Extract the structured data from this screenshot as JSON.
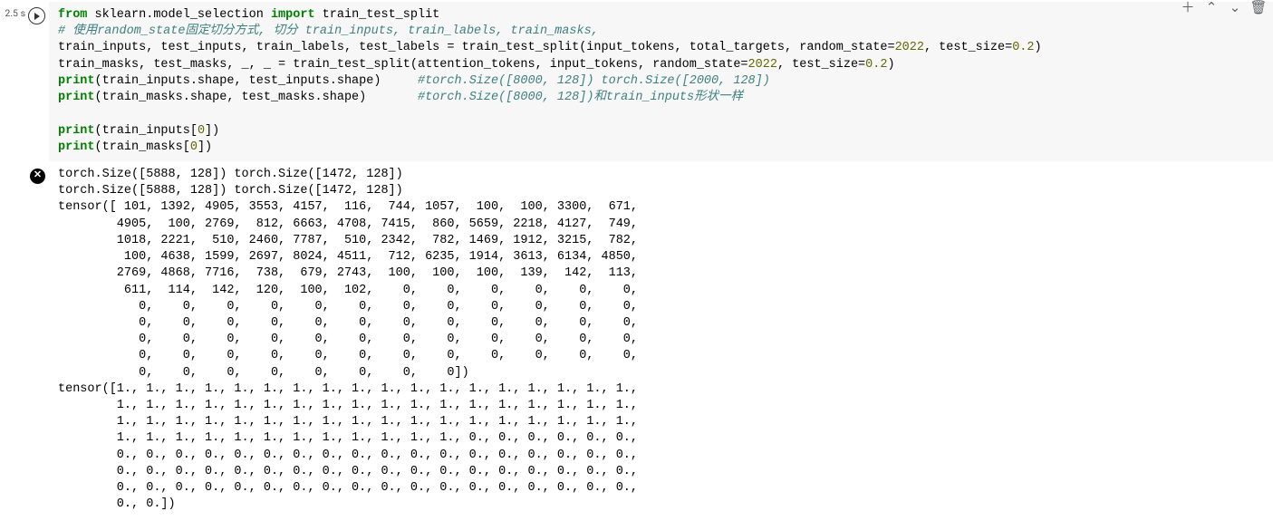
{
  "exec_time": "2.5\ns",
  "toolbar": {
    "add": "＋",
    "up": "⌃",
    "down": "⌄",
    "delete": "🗑"
  },
  "code": {
    "l1_from": "from",
    "l1_mod": " sklearn.model_selection ",
    "l1_import": "import",
    "l1_rest": " train_test_split",
    "l2_comment": "# 使用random_state固定切分方式, 切分 train_inputs, train_labels, train_masks,",
    "l3_a": "train_inputs, test_inputs, train_labels, test_labels = train_test_split(input_tokens, total_targets, random_state=",
    "l3_n1": "2022",
    "l3_b": ", test_size=",
    "l3_n2": "0.2",
    "l3_c": ")",
    "l4_a": "train_masks, test_masks, _, _ = train_test_split(attention_tokens, input_tokens, random_state=",
    "l4_n1": "2022",
    "l4_b": ", test_size=",
    "l4_n2": "0.2",
    "l4_c": ")",
    "l5_print": "print",
    "l5_a": "(train_inputs.shape, test_inputs.shape)     ",
    "l5_comment": "#torch.Size([8000, 128]) torch.Size([2000, 128])",
    "l6_print": "print",
    "l6_a": "(train_masks.shape, test_masks.shape)       ",
    "l6_comment": "#torch.Size([8000, 128])和train_inputs形状一样",
    "blank": "",
    "l7_print": "print",
    "l7_a": "(train_inputs[",
    "l7_n": "0",
    "l7_b": "])",
    "l8_print": "print",
    "l8_a": "(train_masks[",
    "l8_n": "0",
    "l8_b": "])"
  },
  "output": "torch.Size([5888, 128]) torch.Size([1472, 128])\ntorch.Size([5888, 128]) torch.Size([1472, 128])\ntensor([ 101, 1392, 4905, 3553, 4157,  116,  744, 1057,  100,  100, 3300,  671,\n        4905,  100, 2769,  812, 6663, 4708, 7415,  860, 5659, 2218, 4127,  749,\n        1018, 2221,  510, 2460, 7787,  510, 2342,  782, 1469, 1912, 3215,  782,\n         100, 4638, 1599, 2697, 8024, 4511,  712, 6235, 1914, 3613, 6134, 4850,\n        2769, 4868, 7716,  738,  679, 2743,  100,  100,  100,  139,  142,  113,\n         611,  114,  142,  120,  100,  102,    0,    0,    0,    0,    0,    0,\n           0,    0,    0,    0,    0,    0,    0,    0,    0,    0,    0,    0,\n           0,    0,    0,    0,    0,    0,    0,    0,    0,    0,    0,    0,\n           0,    0,    0,    0,    0,    0,    0,    0,    0,    0,    0,    0,\n           0,    0,    0,    0,    0,    0,    0,    0,    0,    0,    0,    0,\n           0,    0,    0,    0,    0,    0,    0,    0])\ntensor([1., 1., 1., 1., 1., 1., 1., 1., 1., 1., 1., 1., 1., 1., 1., 1., 1., 1.,\n        1., 1., 1., 1., 1., 1., 1., 1., 1., 1., 1., 1., 1., 1., 1., 1., 1., 1.,\n        1., 1., 1., 1., 1., 1., 1., 1., 1., 1., 1., 1., 1., 1., 1., 1., 1., 1.,\n        1., 1., 1., 1., 1., 1., 1., 1., 1., 1., 1., 1., 0., 0., 0., 0., 0., 0.,\n        0., 0., 0., 0., 0., 0., 0., 0., 0., 0., 0., 0., 0., 0., 0., 0., 0., 0.,\n        0., 0., 0., 0., 0., 0., 0., 0., 0., 0., 0., 0., 0., 0., 0., 0., 0., 0.,\n        0., 0., 0., 0., 0., 0., 0., 0., 0., 0., 0., 0., 0., 0., 0., 0., 0., 0.,\n        0., 0.])"
}
